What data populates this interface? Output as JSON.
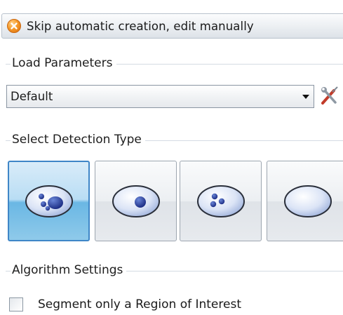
{
  "skip_button": {
    "label": "Skip automatic creation, edit manually",
    "icon": "cancel-circle-icon"
  },
  "load_parameters": {
    "heading": "Load Parameters",
    "selected": "Default",
    "tool_icon": "wrench-screwdriver-icon"
  },
  "detection": {
    "heading": "Select Detection Type",
    "types": [
      {
        "icon": "ellipse-with-cluster-icon",
        "selected": true
      },
      {
        "icon": "ellipse-with-single-dot-icon",
        "selected": false
      },
      {
        "icon": "ellipse-with-three-dots-icon",
        "selected": false
      },
      {
        "icon": "ellipse-plain-icon",
        "selected": false
      }
    ]
  },
  "algorithm": {
    "heading": "Algorithm Settings",
    "roi_checkbox_label": "Segment only a Region of Interest",
    "roi_checked": false
  },
  "colors": {
    "accent_selected": "#3f86c7",
    "skip_icon": "#f0891e"
  }
}
